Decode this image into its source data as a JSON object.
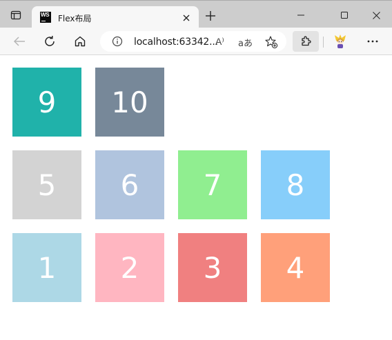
{
  "browser": {
    "tab": {
      "favicon_text": "WS",
      "title": "Flex布局"
    },
    "address": {
      "url": "localhost:63342..."
    },
    "reader_label": "A⁾",
    "translate_label": "aあ"
  },
  "boxes": [
    {
      "label": "9",
      "color": "#20b2aa"
    },
    {
      "label": "10",
      "color": "#778899"
    },
    {
      "label": "5",
      "color": "#d3d3d3"
    },
    {
      "label": "6",
      "color": "#b0c4de"
    },
    {
      "label": "7",
      "color": "#90ee90"
    },
    {
      "label": "8",
      "color": "#87cefa"
    },
    {
      "label": "1",
      "color": "#add8e6"
    },
    {
      "label": "2",
      "color": "#ffb6c1"
    },
    {
      "label": "3",
      "color": "#f08080"
    },
    {
      "label": "4",
      "color": "#ffa07a"
    }
  ]
}
